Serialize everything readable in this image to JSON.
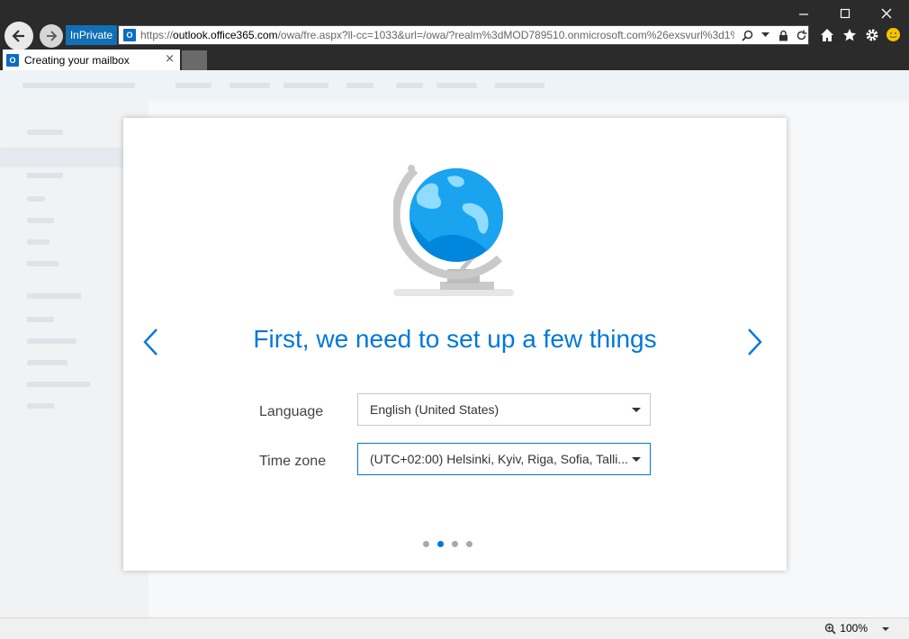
{
  "browser": {
    "inprivate_label": "InPrivate",
    "url_prefix": "https://",
    "url_host": "outlook.office365.com",
    "url_rest": "/owa/fre.aspx?ll-cc=1033&url=/owa/?realm%3dMOD789510.onmicrosoft.com%26exsvurl%3d1%2",
    "tab_title": "Creating your mailbox",
    "tab_close": "×",
    "zoom_level": "100%"
  },
  "dialog": {
    "heading": "First, we need to set up a few things",
    "language_label": "Language",
    "language_value": "English (United States)",
    "timezone_label": "Time zone",
    "timezone_value": "(UTC+02:00) Helsinki, Kyiv, Riga, Sofia, Talli...",
    "pager_total": 4,
    "pager_active": 2
  },
  "colors": {
    "accent": "#0078d7",
    "inprivate_bg": "#1270b6",
    "chrome_bg": "#2b2b2b"
  },
  "icons": {
    "back": "back-arrow-icon",
    "forward": "forward-arrow-icon",
    "home": "home-icon",
    "favorites": "star-icon",
    "tools": "gear-icon",
    "feedback": "smiley-icon"
  }
}
